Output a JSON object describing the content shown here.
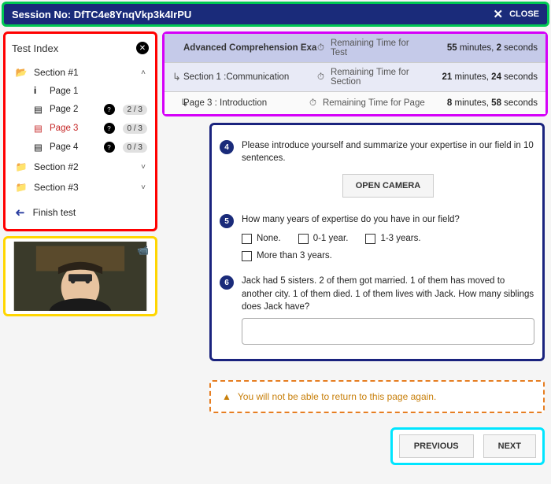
{
  "session": {
    "label": "Session No: DfTC4e8YnqVkp3k4IrPU",
    "close": "CLOSE"
  },
  "index": {
    "title": "Test Index",
    "sections": [
      {
        "label": "Section #1",
        "open": true
      },
      {
        "label": "Section #2",
        "open": false
      },
      {
        "label": "Section #3",
        "open": false
      }
    ],
    "pages": [
      {
        "label": "Page 1",
        "icon": "info",
        "count": "",
        "active": false
      },
      {
        "label": "Page 2",
        "icon": "doc",
        "count": "2 / 3",
        "active": false
      },
      {
        "label": "Page 3",
        "icon": "doc",
        "count": "0 / 3",
        "active": true
      },
      {
        "label": "Page 4",
        "icon": "doc",
        "count": "0 / 3",
        "active": false
      }
    ],
    "finish": "Finish test"
  },
  "header": {
    "exam": "Advanced Comprehension Exam",
    "section": "Section 1 :Communication",
    "page": "Page 3  : Introduction",
    "rt_test_label": "Remaining Time for Test",
    "rt_sec_label": "Remaining Time for Section",
    "rt_page_label": "Remaining Time for Page",
    "rt_test_m": "55",
    "rt_test_s": "2",
    "rt_sec_m": "21",
    "rt_sec_s": "24",
    "rt_page_m": "8",
    "rt_page_s": "58",
    "min_word": " minutes, ",
    "sec_word": " seconds"
  },
  "q4": {
    "num": "4",
    "text": "Please introduce yourself and summarize your expertise in our field in 10 sentences.",
    "btn": "OPEN CAMERA"
  },
  "q5": {
    "num": "5",
    "text": "How many years of expertise do you have in our field?",
    "o1": "None.",
    "o2": "0-1 year.",
    "o3": "1-3 years.",
    "o4": "More than 3 years."
  },
  "q6": {
    "num": "6",
    "text": "Jack had 5 sisters. 2 of them got married. 1 of them has moved to another city. 1 of them died. 1 of them lives with Jack. How many siblings does Jack have?"
  },
  "warning": "You will not be able to return to this page again.",
  "nav": {
    "prev": "PREVIOUS",
    "next": "NEXT"
  }
}
